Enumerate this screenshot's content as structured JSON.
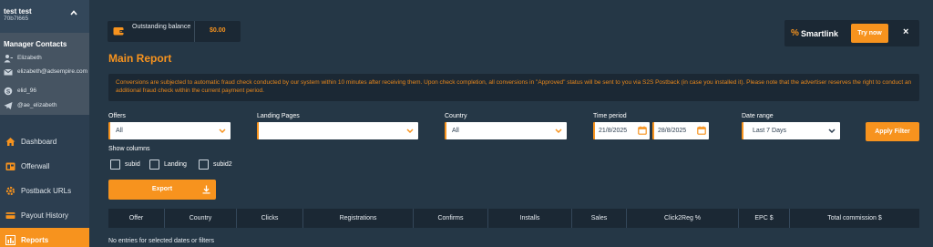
{
  "user": {
    "name": "test test",
    "id": "70b7I665"
  },
  "manager": {
    "title": "Manager Contacts",
    "contacts": [
      {
        "icon": "person-icon",
        "text": "Elizabeth"
      },
      {
        "icon": "envelope-icon",
        "text": "elizabeth@adsempire.com"
      },
      {
        "icon": "skype-icon",
        "text": "elid_96"
      },
      {
        "icon": "telegram-icon",
        "text": "@ae_elizabeth"
      }
    ]
  },
  "nav": [
    {
      "label": "Dashboard",
      "icon": "home-icon"
    },
    {
      "label": "Offerwall",
      "icon": "offerwall-icon"
    },
    {
      "label": "Postback URLs",
      "icon": "gear-icon"
    },
    {
      "label": "Payout History",
      "icon": "card-icon"
    },
    {
      "label": "Reports",
      "icon": "chart-icon",
      "active": true
    }
  ],
  "balance": {
    "label": "Outstanding balance",
    "value": "$0.00"
  },
  "smartlink": {
    "symbol": "%",
    "title": "Smartlink",
    "button": "Try now",
    "close": "×"
  },
  "page_title": "Main Report",
  "notice": "Conversions are subjected to automatic fraud check conducted by our system within 10 minutes after receiving them. Upon check completion, all conversions in \"Approved\" status will be sent to you via S2S Postback (in case you installed it). Please note that the advertiser reserves the right to conduct an additional fraud check within the current payment period.",
  "filters": {
    "offers": {
      "label": "Offers",
      "value": "All"
    },
    "landing": {
      "label": "Landing Pages",
      "value": ""
    },
    "country": {
      "label": "Country",
      "value": "All"
    },
    "time_period": {
      "label": "Time period",
      "from": "21/8/2025",
      "to": "28/8/2025"
    },
    "date_range": {
      "label": "Date range",
      "value": "Last 7 Days"
    },
    "apply": "Apply Filter"
  },
  "show_columns": {
    "label": "Show columns",
    "options": [
      {
        "label": "subid",
        "checked": false
      },
      {
        "label": "Landing",
        "checked": false
      },
      {
        "label": "subid2",
        "checked": false
      }
    ]
  },
  "export": "Export",
  "table": {
    "headers": [
      "Offer",
      "Country",
      "Clicks",
      "Registrations",
      "Confirms",
      "Installs",
      "Sales",
      "Click2Reg %",
      "EPC $",
      "Total commission $"
    ],
    "empty": "No entries for selected dates or filters"
  },
  "colors": {
    "accent": "#f7931e",
    "background": "#253746",
    "panel": "#1b2834",
    "sidebar": "#2c3e50"
  }
}
